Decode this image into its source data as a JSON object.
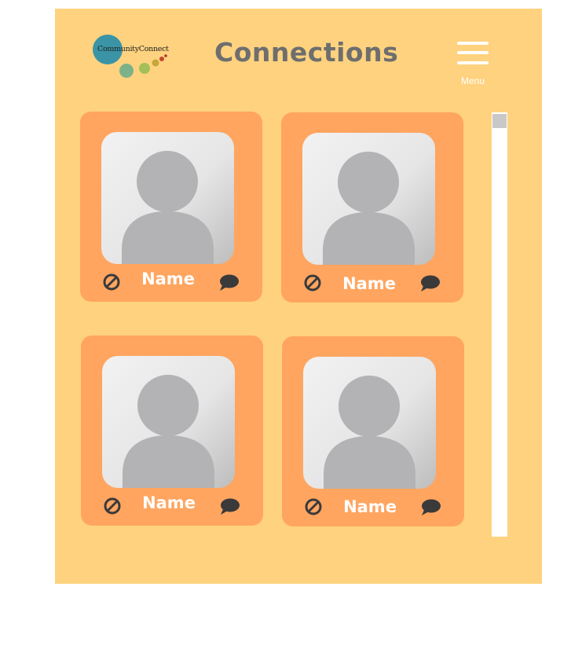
{
  "header": {
    "logo_text": "CommunityConnect",
    "title": "Connections",
    "menu_label": "Menu",
    "menu_icon": "hamburger-icon"
  },
  "connections": [
    {
      "name": "Name",
      "avatar_icon": "person-placeholder-icon",
      "block_icon": "block-icon",
      "message_icon": "chat-bubble-icon"
    },
    {
      "name": "Name",
      "avatar_icon": "person-placeholder-icon",
      "block_icon": "block-icon",
      "message_icon": "chat-bubble-icon"
    },
    {
      "name": "Name",
      "avatar_icon": "person-placeholder-icon",
      "block_icon": "block-icon",
      "message_icon": "chat-bubble-icon"
    },
    {
      "name": "Name",
      "avatar_icon": "person-placeholder-icon",
      "block_icon": "block-icon",
      "message_icon": "chat-bubble-icon"
    }
  ],
  "colors": {
    "page_background": "#ffd27f",
    "card_background": "#ffa560",
    "title_text": "#6e6e6e",
    "icon_color": "#3a3a3a"
  }
}
